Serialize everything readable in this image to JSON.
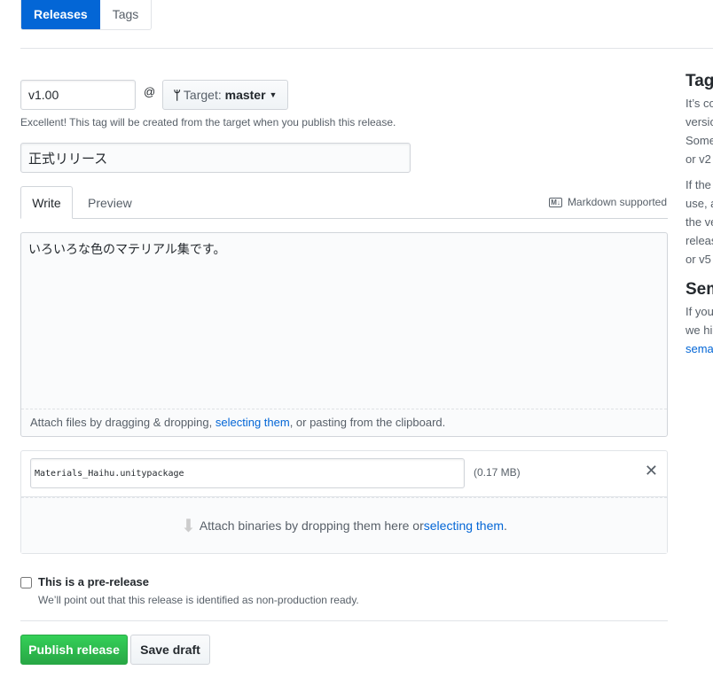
{
  "nav": {
    "releases": "Releases",
    "tags": "Tags"
  },
  "tag": {
    "value": "v1.00",
    "at": "@",
    "target_label": "Target:",
    "target_branch": "master",
    "hint": "Excellent! This tag will be created from the target when you publish this release."
  },
  "title": {
    "value": "正式リリース"
  },
  "editor": {
    "tabs": [
      "Write",
      "Preview"
    ],
    "markdown": "Markdown supported",
    "body": "いろいろな色のマテリアル集です。",
    "attach_pre": "Attach files by dragging & dropping, ",
    "attach_link": "selecting them",
    "attach_post": ", or pasting from the clipboard."
  },
  "uploads": {
    "file": "Materials_Haihu.unitypackage",
    "size": "(0.17 MB)",
    "drop_pre": "Attach binaries by dropping them here or ",
    "drop_link": "selecting them",
    "drop_post": "."
  },
  "prerelease": {
    "label": "This is a pre-release",
    "desc": "We’ll point out that this release is identified as non-production ready.",
    "checked": false
  },
  "actions": {
    "publish": "Publish release",
    "draft": "Save draft"
  },
  "sidebar": {
    "h1": "Tag",
    "p1": [
      "It’s co",
      "versio",
      "Some",
      "or v2"
    ],
    "p2": [
      "If the",
      "use, a",
      "the ve",
      "releas",
      "or v5"
    ],
    "h2": "Sem",
    "p3": [
      "If you",
      "we hi"
    ],
    "link": "sema"
  }
}
